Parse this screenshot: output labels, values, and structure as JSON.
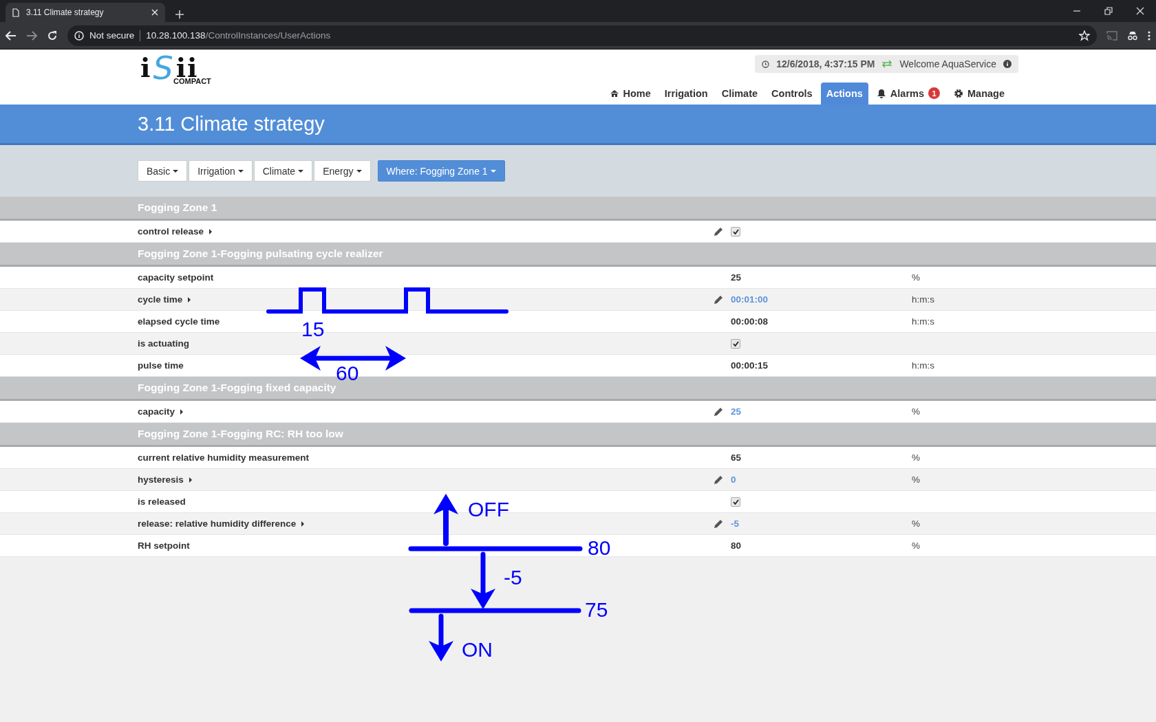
{
  "browser": {
    "tab_title": "3.11 Climate strategy",
    "security": "Not secure",
    "url_host": "10.28.100.138",
    "url_path": "/ControlInstances/UserActions"
  },
  "logo": {
    "parts": [
      "i",
      "S",
      "ii"
    ],
    "subtitle": "COMPACT"
  },
  "status": {
    "datetime": "12/6/2018, 4:37:15 PM",
    "welcome": "Welcome AquaService"
  },
  "nav": [
    {
      "label": "Home",
      "selected": false
    },
    {
      "label": "Irrigation",
      "selected": false
    },
    {
      "label": "Climate",
      "selected": false
    },
    {
      "label": "Controls",
      "selected": false
    },
    {
      "label": "Actions",
      "selected": true
    },
    {
      "label": "Alarms",
      "badge": "1",
      "selected": false
    },
    {
      "label": "Manage",
      "selected": false
    }
  ],
  "page_title": "3.11 Climate strategy",
  "filters": [
    {
      "label": "Basic",
      "kind": "default"
    },
    {
      "label": "Irrigation",
      "kind": "default"
    },
    {
      "label": "Climate",
      "kind": "default"
    },
    {
      "label": "Energy",
      "kind": "default"
    },
    {
      "label": "Where: Fogging Zone 1",
      "kind": "primary"
    }
  ],
  "sections": [
    {
      "title": "Fogging Zone 1",
      "rows": [
        {
          "label": "control release",
          "expandable": true,
          "editable": true,
          "kind": "check",
          "checked": true
        }
      ]
    },
    {
      "title": "Fogging Zone 1-Fogging pulsating cycle realizer",
      "rows": [
        {
          "label": "capacity setpoint",
          "expandable": false,
          "editable": false,
          "kind": "text",
          "value": "25",
          "unit": "%"
        },
        {
          "label": "cycle time",
          "expandable": true,
          "editable": true,
          "kind": "text",
          "value": "00:01:00",
          "unit": "h:m:s"
        },
        {
          "label": "elapsed cycle time",
          "expandable": false,
          "editable": false,
          "kind": "text",
          "value": "00:00:08",
          "unit": "h:m:s"
        },
        {
          "label": "is actuating",
          "expandable": false,
          "editable": false,
          "kind": "check",
          "checked": true
        },
        {
          "label": "pulse time",
          "expandable": false,
          "editable": false,
          "kind": "text",
          "value": "00:00:15",
          "unit": "h:m:s"
        }
      ]
    },
    {
      "title": "Fogging Zone 1-Fogging fixed capacity",
      "rows": [
        {
          "label": "capacity",
          "expandable": true,
          "editable": true,
          "kind": "text",
          "value": "25",
          "unit": "%"
        }
      ]
    },
    {
      "title": "Fogging Zone 1-Fogging RC: RH too low",
      "rows": [
        {
          "label": "current relative humidity measurement",
          "expandable": false,
          "editable": false,
          "kind": "text",
          "value": "65",
          "unit": "%"
        },
        {
          "label": "hysteresis",
          "expandable": true,
          "editable": true,
          "kind": "text",
          "value": "0",
          "unit": "%"
        },
        {
          "label": "is released",
          "expandable": false,
          "editable": false,
          "kind": "check",
          "checked": true
        },
        {
          "label": "release: relative humidity difference",
          "expandable": true,
          "editable": true,
          "kind": "text",
          "value": "-5",
          "unit": "%"
        },
        {
          "label": "RH setpoint",
          "expandable": false,
          "editable": false,
          "kind": "text",
          "value": "80",
          "unit": "%"
        }
      ]
    }
  ],
  "annotations": [
    "15",
    "60",
    "OFF",
    "80",
    "-5",
    "75",
    "ON"
  ]
}
